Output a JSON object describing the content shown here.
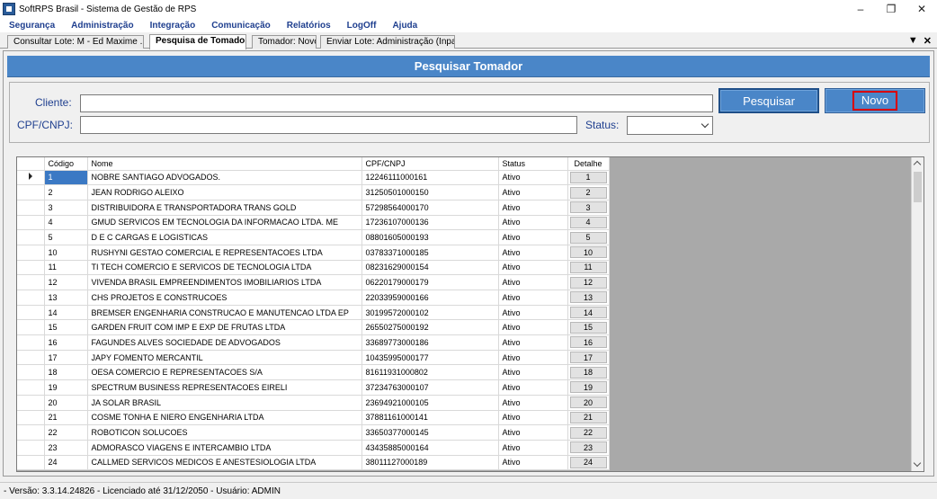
{
  "window": {
    "title": "SoftRPS Brasil - Sistema de Gestão de RPS",
    "minimize": "–",
    "restore": "❐",
    "close": "✕"
  },
  "menu": [
    "Segurança",
    "Administração",
    "Integração",
    "Comunicação",
    "Relatórios",
    "LogOff",
    "Ajuda"
  ],
  "tabs": [
    {
      "label": "Consultar Lote: M - Ed Maxime ..."
    },
    {
      "label": "Pesquisa de Tomadores",
      "active": true
    },
    {
      "label": "Tomador: Novo"
    },
    {
      "label": "Enviar Lote: Administração (Inpa..."
    }
  ],
  "tab_controls": {
    "dropdown": "▼",
    "close": "✕"
  },
  "header": {
    "title": "Pesquisar Tomador"
  },
  "form": {
    "cliente_label": "Cliente:",
    "cliente_value": "",
    "cpf_label": "CPF/CNPJ:",
    "cpf_value": "",
    "status_label": "Status:",
    "status_value": "",
    "pesquisar_label": "Pesquisar",
    "novo_label": "Novo"
  },
  "grid": {
    "columns": [
      "Código",
      "Nome",
      "CPF/CNPJ",
      "Status",
      "Detalhe"
    ],
    "current_row": 0,
    "rows": [
      [
        "1",
        "NOBRE SANTIAGO ADVOGADOS.",
        "12246111000161",
        "Ativo",
        "1"
      ],
      [
        "2",
        "JEAN RODRIGO ALEIXO",
        "31250501000150",
        "Ativo",
        "2"
      ],
      [
        "3",
        "DISTRIBUIDORA E TRANSPORTADORA TRANS GOLD",
        "57298564000170",
        "Ativo",
        "3"
      ],
      [
        "4",
        "GMUD SERVICOS EM TECNOLOGIA DA INFORMACAO LTDA. ME",
        "17236107000136",
        "Ativo",
        "4"
      ],
      [
        "5",
        "D E C CARGAS E LOGISTICAS",
        "08801605000193",
        "Ativo",
        "5"
      ],
      [
        "10",
        "RUSHYNI GESTAO COMERCIAL E REPRESENTACOES LTDA",
        "03783371000185",
        "Ativo",
        "10"
      ],
      [
        "11",
        "TI TECH COMERCIO E SERVICOS DE TECNOLOGIA LTDA",
        "08231629000154",
        "Ativo",
        "11"
      ],
      [
        "12",
        "VIVENDA BRASIL EMPREENDIMENTOS IMOBILIARIOS LTDA",
        "06220179000179",
        "Ativo",
        "12"
      ],
      [
        "13",
        "CHS PROJETOS E CONSTRUCOES",
        "22033959000166",
        "Ativo",
        "13"
      ],
      [
        "14",
        "BREMSER ENGENHARIA CONSTRUCAO E MANUTENCAO LTDA EP",
        "30199572000102",
        "Ativo",
        "14"
      ],
      [
        "15",
        "GARDEN FRUIT COM IMP E EXP DE FRUTAS LTDA",
        "26550275000192",
        "Ativo",
        "15"
      ],
      [
        "16",
        "FAGUNDES ALVES SOCIEDADE DE ADVOGADOS",
        "33689773000186",
        "Ativo",
        "16"
      ],
      [
        "17",
        "JAPY FOMENTO MERCANTIL",
        "10435995000177",
        "Ativo",
        "17"
      ],
      [
        "18",
        "OESA COMERCIO E REPRESENTACOES S/A",
        "81611931000802",
        "Ativo",
        "18"
      ],
      [
        "19",
        "SPECTRUM BUSINESS REPRESENTACOES EIRELI",
        "37234763000107",
        "Ativo",
        "19"
      ],
      [
        "20",
        "JA SOLAR BRASIL",
        "23694921000105",
        "Ativo",
        "20"
      ],
      [
        "21",
        "COSME TONHA E NIERO ENGENHARIA LTDA",
        "37881161000141",
        "Ativo",
        "21"
      ],
      [
        "22",
        "ROBOTICON SOLUCOES",
        "33650377000145",
        "Ativo",
        "22"
      ],
      [
        "23",
        "ADMORASCO VIAGENS E INTERCAMBIO LTDA",
        "43435885000164",
        "Ativo",
        "23"
      ],
      [
        "24",
        "CALLMED SERVICOS MEDICOS E ANESTESIOLOGIA LTDA",
        "38011127000189",
        "Ativo",
        "24"
      ]
    ]
  },
  "status_bar": {
    "text": "- Versão: 3.3.14.24826 - Licenciado até 31/12/2050 - Usuário: ADMIN"
  }
}
